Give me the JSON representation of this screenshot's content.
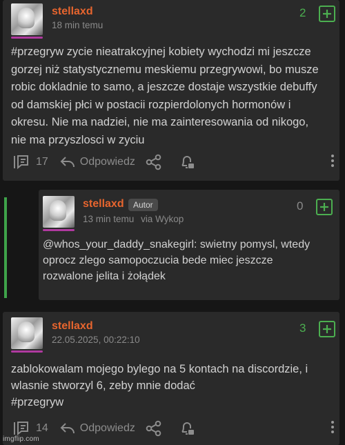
{
  "posts": [
    {
      "username": "stellaxd",
      "time": "18 min temu",
      "score": "2",
      "content_lines": [
        "#przegryw zycie nieatrakcyjnej kobiety wychodzi mi jeszcze",
        "gorzej niż statystycznemu meskiemu przegrywowi, bo musze",
        "robic dokladnie to samo, a jeszcze dostaje wszystkie debuffy",
        "od damskiej płci w postacii rozpierdolonych hormonów i",
        "okresu. Nie ma nadziei, nie ma zainteresowania od nikogo,",
        "nie ma przyszlosci w zyciu"
      ],
      "comments_count": "17",
      "reply_label": "Odpowiedz"
    },
    {
      "username": "stellaxd",
      "badge": "Autor",
      "time": "13 min temu",
      "via": "via Wykop",
      "score": "0",
      "content_lines": [
        "@whos_your_daddy_snakegirl: swietny pomysl, wtedy",
        "oprocz zlego samopoczucia bede miec jeszcze",
        "rozwalone jelita i żołądek"
      ]
    },
    {
      "username": "stellaxd",
      "time": "22.05.2025, 00:22:10",
      "score": "3",
      "content_lines": [
        "zablokowalam mojego bylego na 5 kontach na discordzie, i",
        "wlasnie stworzyl 6, zeby mnie dodać",
        "#przegryw"
      ],
      "comments_count": "14",
      "reply_label": "Odpowiedz"
    }
  ],
  "watermark": "imgflip.com",
  "colors": {
    "username": "#e7652e",
    "vote_green": "#4caf50",
    "thread_line": "#3ea34a",
    "avatar_bar": "#b03aa0",
    "card_bg": "#2a2a2a",
    "page_bg": "#161616"
  }
}
